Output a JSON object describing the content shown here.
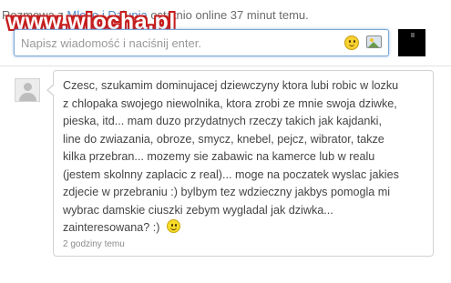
{
  "header": {
    "prefix": "Rozmowa z",
    "contact_name": "Mleko i Dziunia",
    "status": "ostatnio online 37 minut temu."
  },
  "watermark": "www.wiocha.pl",
  "composer": {
    "placeholder": "Napisz wiadomość i naciśnij enter.",
    "value": ""
  },
  "icons": {
    "composer": [
      "smiley-icon",
      "photo-icon"
    ],
    "avatar": "user-avatar-icon"
  },
  "message": {
    "lines": [
      "Czesc, szukamim dominujacej dziewczyny ktora lubi robic w lozku",
      "z chlopaka swojego niewolnika, ktora zrobi ze mnie swoja dziwke,",
      "pieska, itd... mam duzo przydatnych rzeczy takich jak kajdanki,",
      "line do zwiazania, obroze, smycz, knebel, pejcz, wibrator, takze",
      "kilka przebran... mozemy sie zabawic na kamerce lub w realu",
      "(jestem skolnny zaplacic z real)... moge na poczatek wyslac jakies",
      "zdjecie w przebraniu :) bylbym tez wdzieczny jakbys pomogla mi",
      "wybrac damskie ciuszki zebym wygladal jak dziwka...",
      "zainteresowana? :)"
    ],
    "timestamp": "2 godziny temu"
  }
}
